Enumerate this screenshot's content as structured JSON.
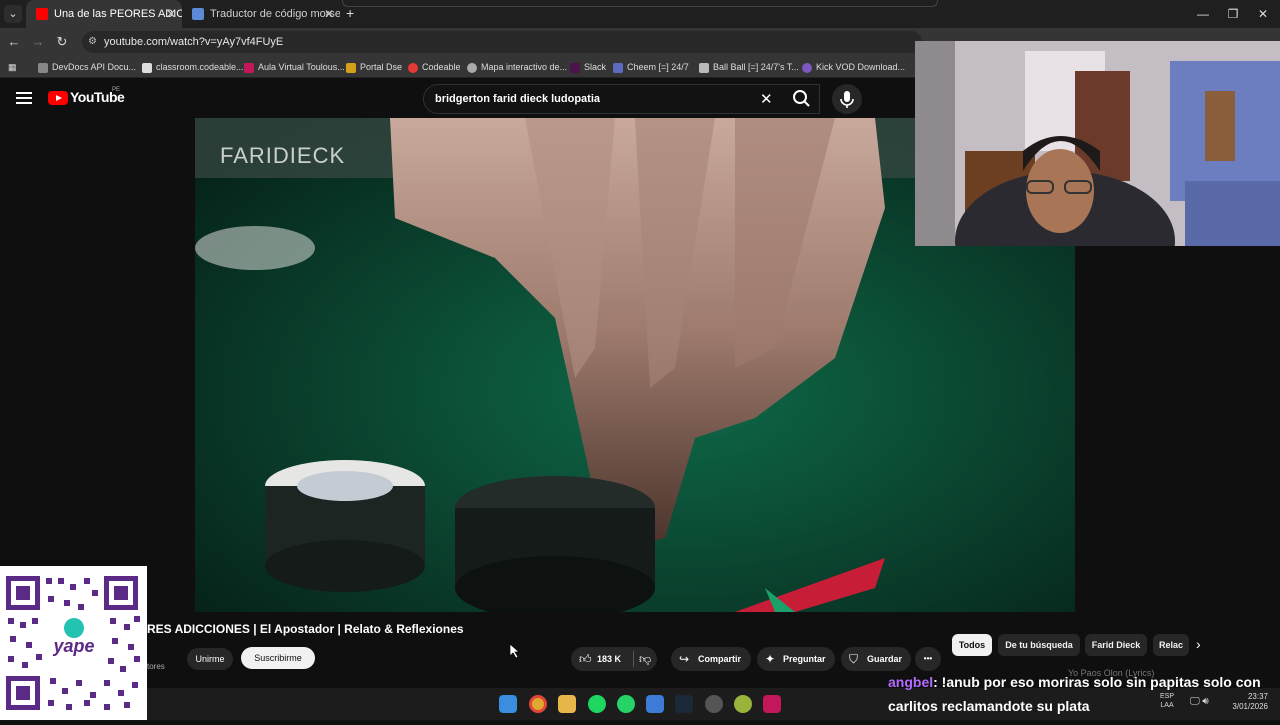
{
  "browser": {
    "tabs": [
      {
        "title": "Una de las PEORES ADICCI",
        "active": true
      },
      {
        "title": "Traductor de código morse",
        "active": false
      }
    ],
    "new_tab": "+",
    "window_controls": {
      "minimize": "—",
      "maximize": "❐",
      "close": "✕"
    },
    "url": "youtube.com/watch?v=yAy7vf4FUyE",
    "bookmarks": [
      "DevDocs API Docu...",
      "classroom.codeable....",
      "Aula Virtual Toulous...",
      "Portal Dse",
      "Codeable",
      "Mapa interactivo de...",
      "Slack",
      "Cheem [=] 24/7",
      "Ball Ball [=] 24/7's T...",
      "Kick VOD Download..."
    ]
  },
  "youtube": {
    "logo_text": "YouTube",
    "region": "PE",
    "search_query": "bridgerton farid dieck ludopatia",
    "video": {
      "watermark": "FARIDIECK",
      "title": "RES ADICCIONES | El Apostador | Relato & Reflexiones",
      "subscribers": "tores",
      "join_label": "Unirme",
      "subscribe_label": "Suscribirme",
      "likes": "183 K",
      "share_label": "Compartir",
      "ask_label": "Preguntar",
      "save_label": "Guardar",
      "more_label": "•••"
    },
    "chips": [
      "Todos",
      "De tu búsqueda",
      "Farid Dieck",
      "Relac"
    ],
    "next_song": "Yo Paos Olon (Lyrics)"
  },
  "chat": {
    "user": "angbel",
    "message": ": !anub por eso moriras solo sin papitas solo con carlitos reclamandote su plata"
  },
  "taskbar": {
    "lang": "ESP",
    "lang2": "LAA",
    "time": "23:37",
    "date": "3/01/2026"
  },
  "colors": {
    "accent": "#ff0000",
    "chat_user": "#b36bff",
    "felt": "#0d3b2a"
  }
}
